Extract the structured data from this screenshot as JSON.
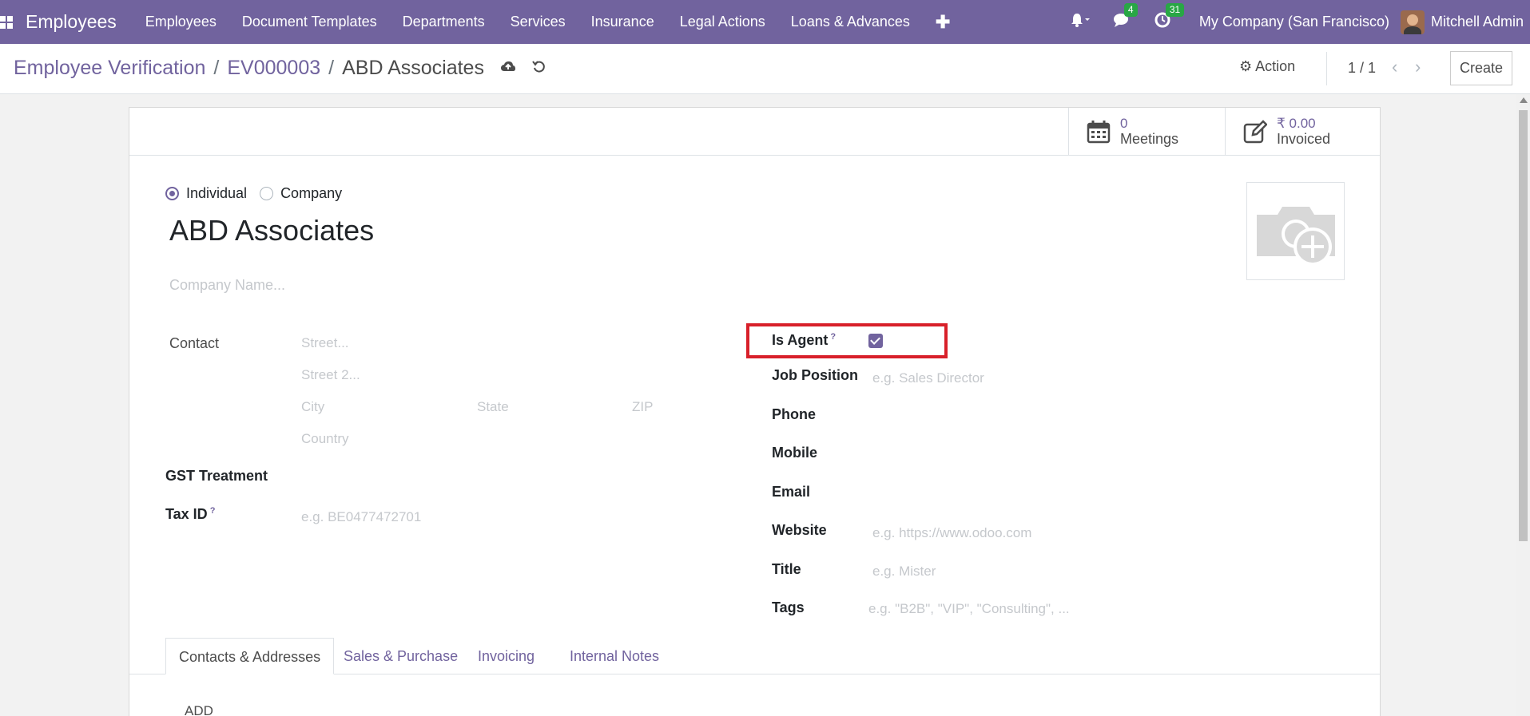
{
  "navbar": {
    "app_name": "Employees",
    "menu": [
      "Employees",
      "Document Templates",
      "Departments",
      "Services",
      "Insurance",
      "Legal Actions",
      "Loans & Advances"
    ],
    "plus": "✚",
    "messages_badge": "4",
    "activities_badge": "31",
    "company": "My Company (San Francisco)",
    "user": "Mitchell Admin"
  },
  "control": {
    "crumb_1": "Employee Verification",
    "crumb_2": "EV000003",
    "crumb_current": "ABD Associates",
    "sep": "/",
    "action": "Action",
    "pager": "1 / 1",
    "create": "Create"
  },
  "smart": {
    "meetings_value": "0",
    "meetings_label": "Meetings",
    "invoiced_value": "₹ 0.00",
    "invoiced_label": "Invoiced"
  },
  "form": {
    "radio_individual": "Individual",
    "radio_company": "Company",
    "name": "ABD Associates",
    "company_name_placeholder": "Company Name...",
    "contact_label": "Contact",
    "street_ph": "Street...",
    "street2_ph": "Street 2...",
    "city_ph": "City",
    "state_ph": "State",
    "zip_ph": "ZIP",
    "country_ph": "Country",
    "gst_label": "GST Treatment",
    "taxid_label": "Tax ID",
    "taxid_ph": "e.g. BE0477472701",
    "help_mark": "?",
    "is_agent_label": "Is Agent",
    "is_agent_checked": true,
    "job_position_label": "Job Position",
    "job_position_ph": "e.g. Sales Director",
    "phone_label": "Phone",
    "mobile_label": "Mobile",
    "email_label": "Email",
    "website_label": "Website",
    "website_ph": "e.g. https://www.odoo.com",
    "title_label": "Title",
    "title_ph": "e.g. Mister",
    "tags_label": "Tags",
    "tags_ph": "e.g. \"B2B\", \"VIP\", \"Consulting\", ..."
  },
  "tabs": [
    "Contacts & Addresses",
    "Sales & Purchase",
    "Invoicing",
    "Internal Notes"
  ],
  "add_text": "ADD"
}
